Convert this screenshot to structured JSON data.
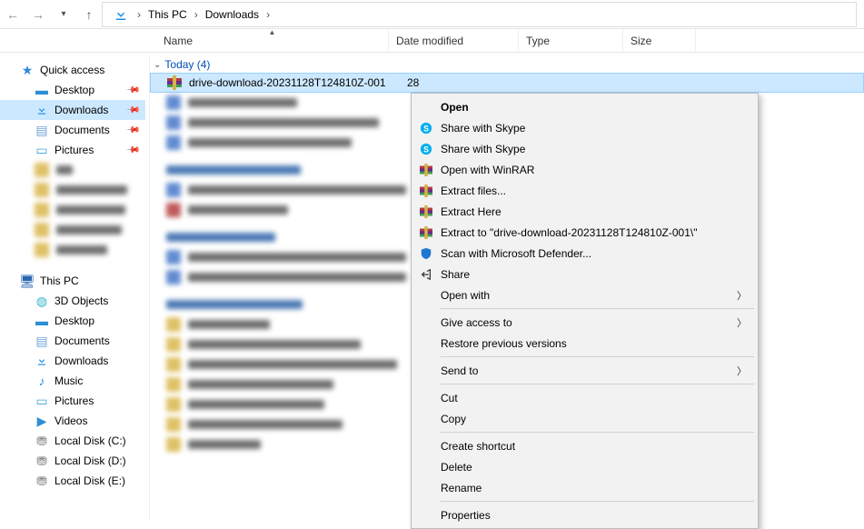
{
  "breadcrumb": {
    "seg1": "This PC",
    "seg2": "Downloads"
  },
  "columns": {
    "name": "Name",
    "date": "Date modified",
    "type": "Type",
    "size": "Size"
  },
  "sidebar": {
    "quick": "Quick access",
    "items": [
      {
        "label": "Desktop",
        "pinned": true
      },
      {
        "label": "Downloads",
        "pinned": true
      },
      {
        "label": "Documents",
        "pinned": true
      },
      {
        "label": "Pictures",
        "pinned": true
      }
    ],
    "thispc": "This PC",
    "pc_items": [
      {
        "label": "3D Objects"
      },
      {
        "label": "Desktop"
      },
      {
        "label": "Documents"
      },
      {
        "label": "Downloads"
      },
      {
        "label": "Music"
      },
      {
        "label": "Pictures"
      },
      {
        "label": "Videos"
      },
      {
        "label": "Local Disk (C:)"
      },
      {
        "label": "Local Disk (D:)"
      },
      {
        "label": "Local Disk (E:)"
      }
    ]
  },
  "group": {
    "label": "Today (4)"
  },
  "file": {
    "name": "drive-download-20231128T124810Z-001",
    "date_prefix": "28"
  },
  "ctx": {
    "open": "Open",
    "skype1": "Share with Skype",
    "skype2": "Share with Skype",
    "winrar": "Open with WinRAR",
    "extract_files": "Extract files...",
    "extract_here": "Extract Here",
    "extract_to": "Extract to \"drive-download-20231128T124810Z-001\\\"",
    "defender": "Scan with Microsoft Defender...",
    "share": "Share",
    "open_with": "Open with",
    "give_access": "Give access to",
    "restore": "Restore previous versions",
    "send_to": "Send to",
    "cut": "Cut",
    "copy": "Copy",
    "shortcut": "Create shortcut",
    "delete": "Delete",
    "rename": "Rename",
    "properties": "Properties"
  }
}
